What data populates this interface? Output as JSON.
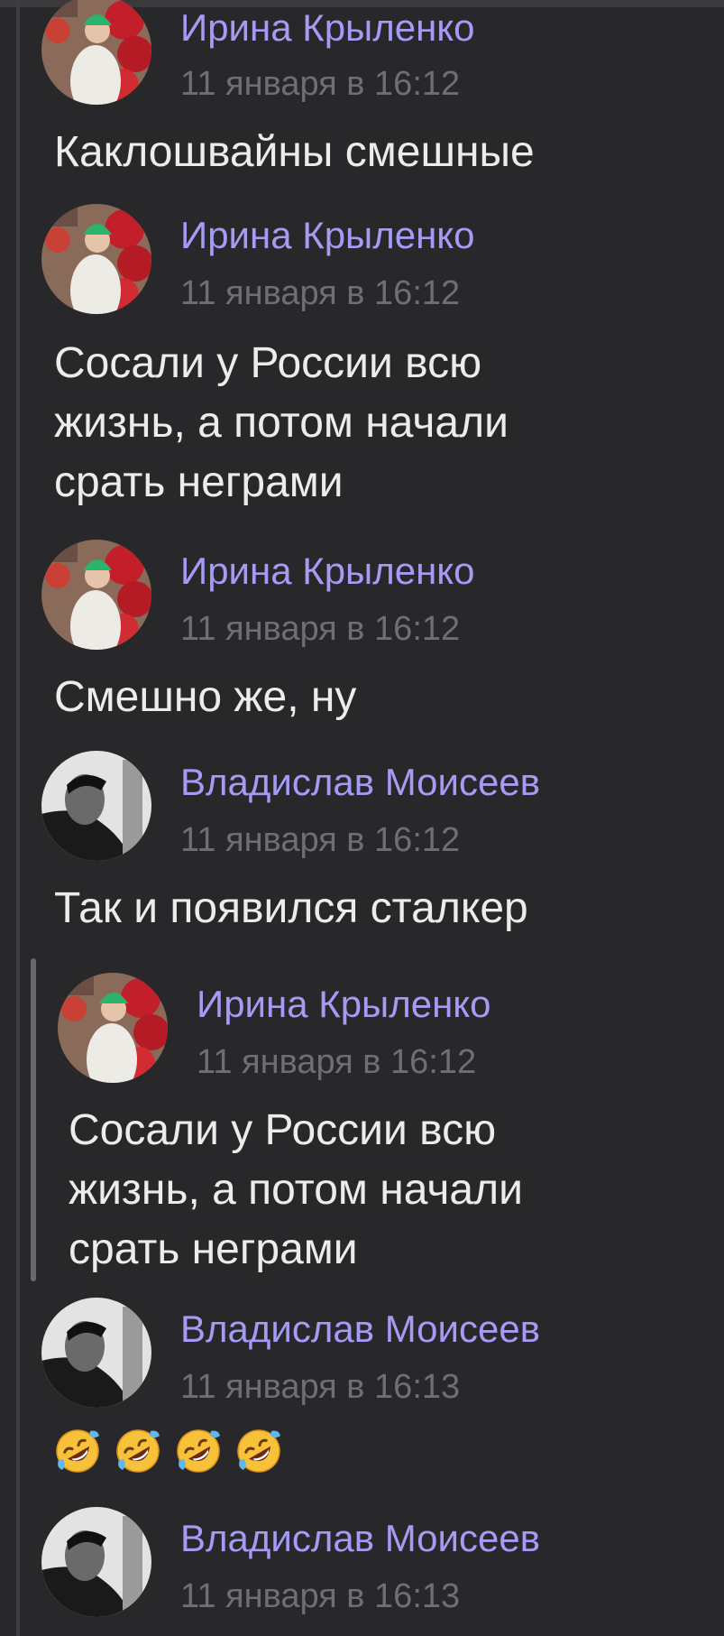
{
  "messages": [
    {
      "author": "Ирина Крыленко",
      "time": "11 января в 16:12",
      "text": "Каклошвайны смешные",
      "avatar": "irina-avatar"
    },
    {
      "author": "Ирина Крыленко",
      "time": "11 января в 16:12",
      "text": "Сосали у России всю\nжизнь, а потом начали\nсрать неграми",
      "avatar": "irina-avatar"
    },
    {
      "author": "Ирина Крыленко",
      "time": "11 января в 16:12",
      "text": "Смешно же, ну",
      "avatar": "irina-avatar"
    },
    {
      "author": "Владислав Моисеев",
      "time": "11 января в 16:12",
      "text": "Так и появился сталкер",
      "avatar": "vladislav-avatar"
    },
    {
      "author": "Владислав Моисеев",
      "time": "11 января в 16:13",
      "text": "",
      "avatar": "vladislav-avatar",
      "emoji": [
        "rolling-on-floor-laughing-emoji",
        "rolling-on-floor-laughing-emoji",
        "rolling-on-floor-laughing-emoji",
        "rolling-on-floor-laughing-emoji"
      ]
    },
    {
      "author": "Владислав Моисеев",
      "time": "11 января в 16:13",
      "text": "",
      "avatar": "vladislav-avatar"
    }
  ],
  "quote": {
    "author": "Ирина Крыленко",
    "time": "11 января в 16:12",
    "text": "Сосали у России всю\nжизнь, а потом начали\nсрать неграми",
    "avatar": "irina-avatar"
  },
  "colors": {
    "background": "#28282a",
    "author": "#a59bf5",
    "time": "#6f6f73",
    "text": "#ececec",
    "quote_bar": "#6a6a6e"
  }
}
